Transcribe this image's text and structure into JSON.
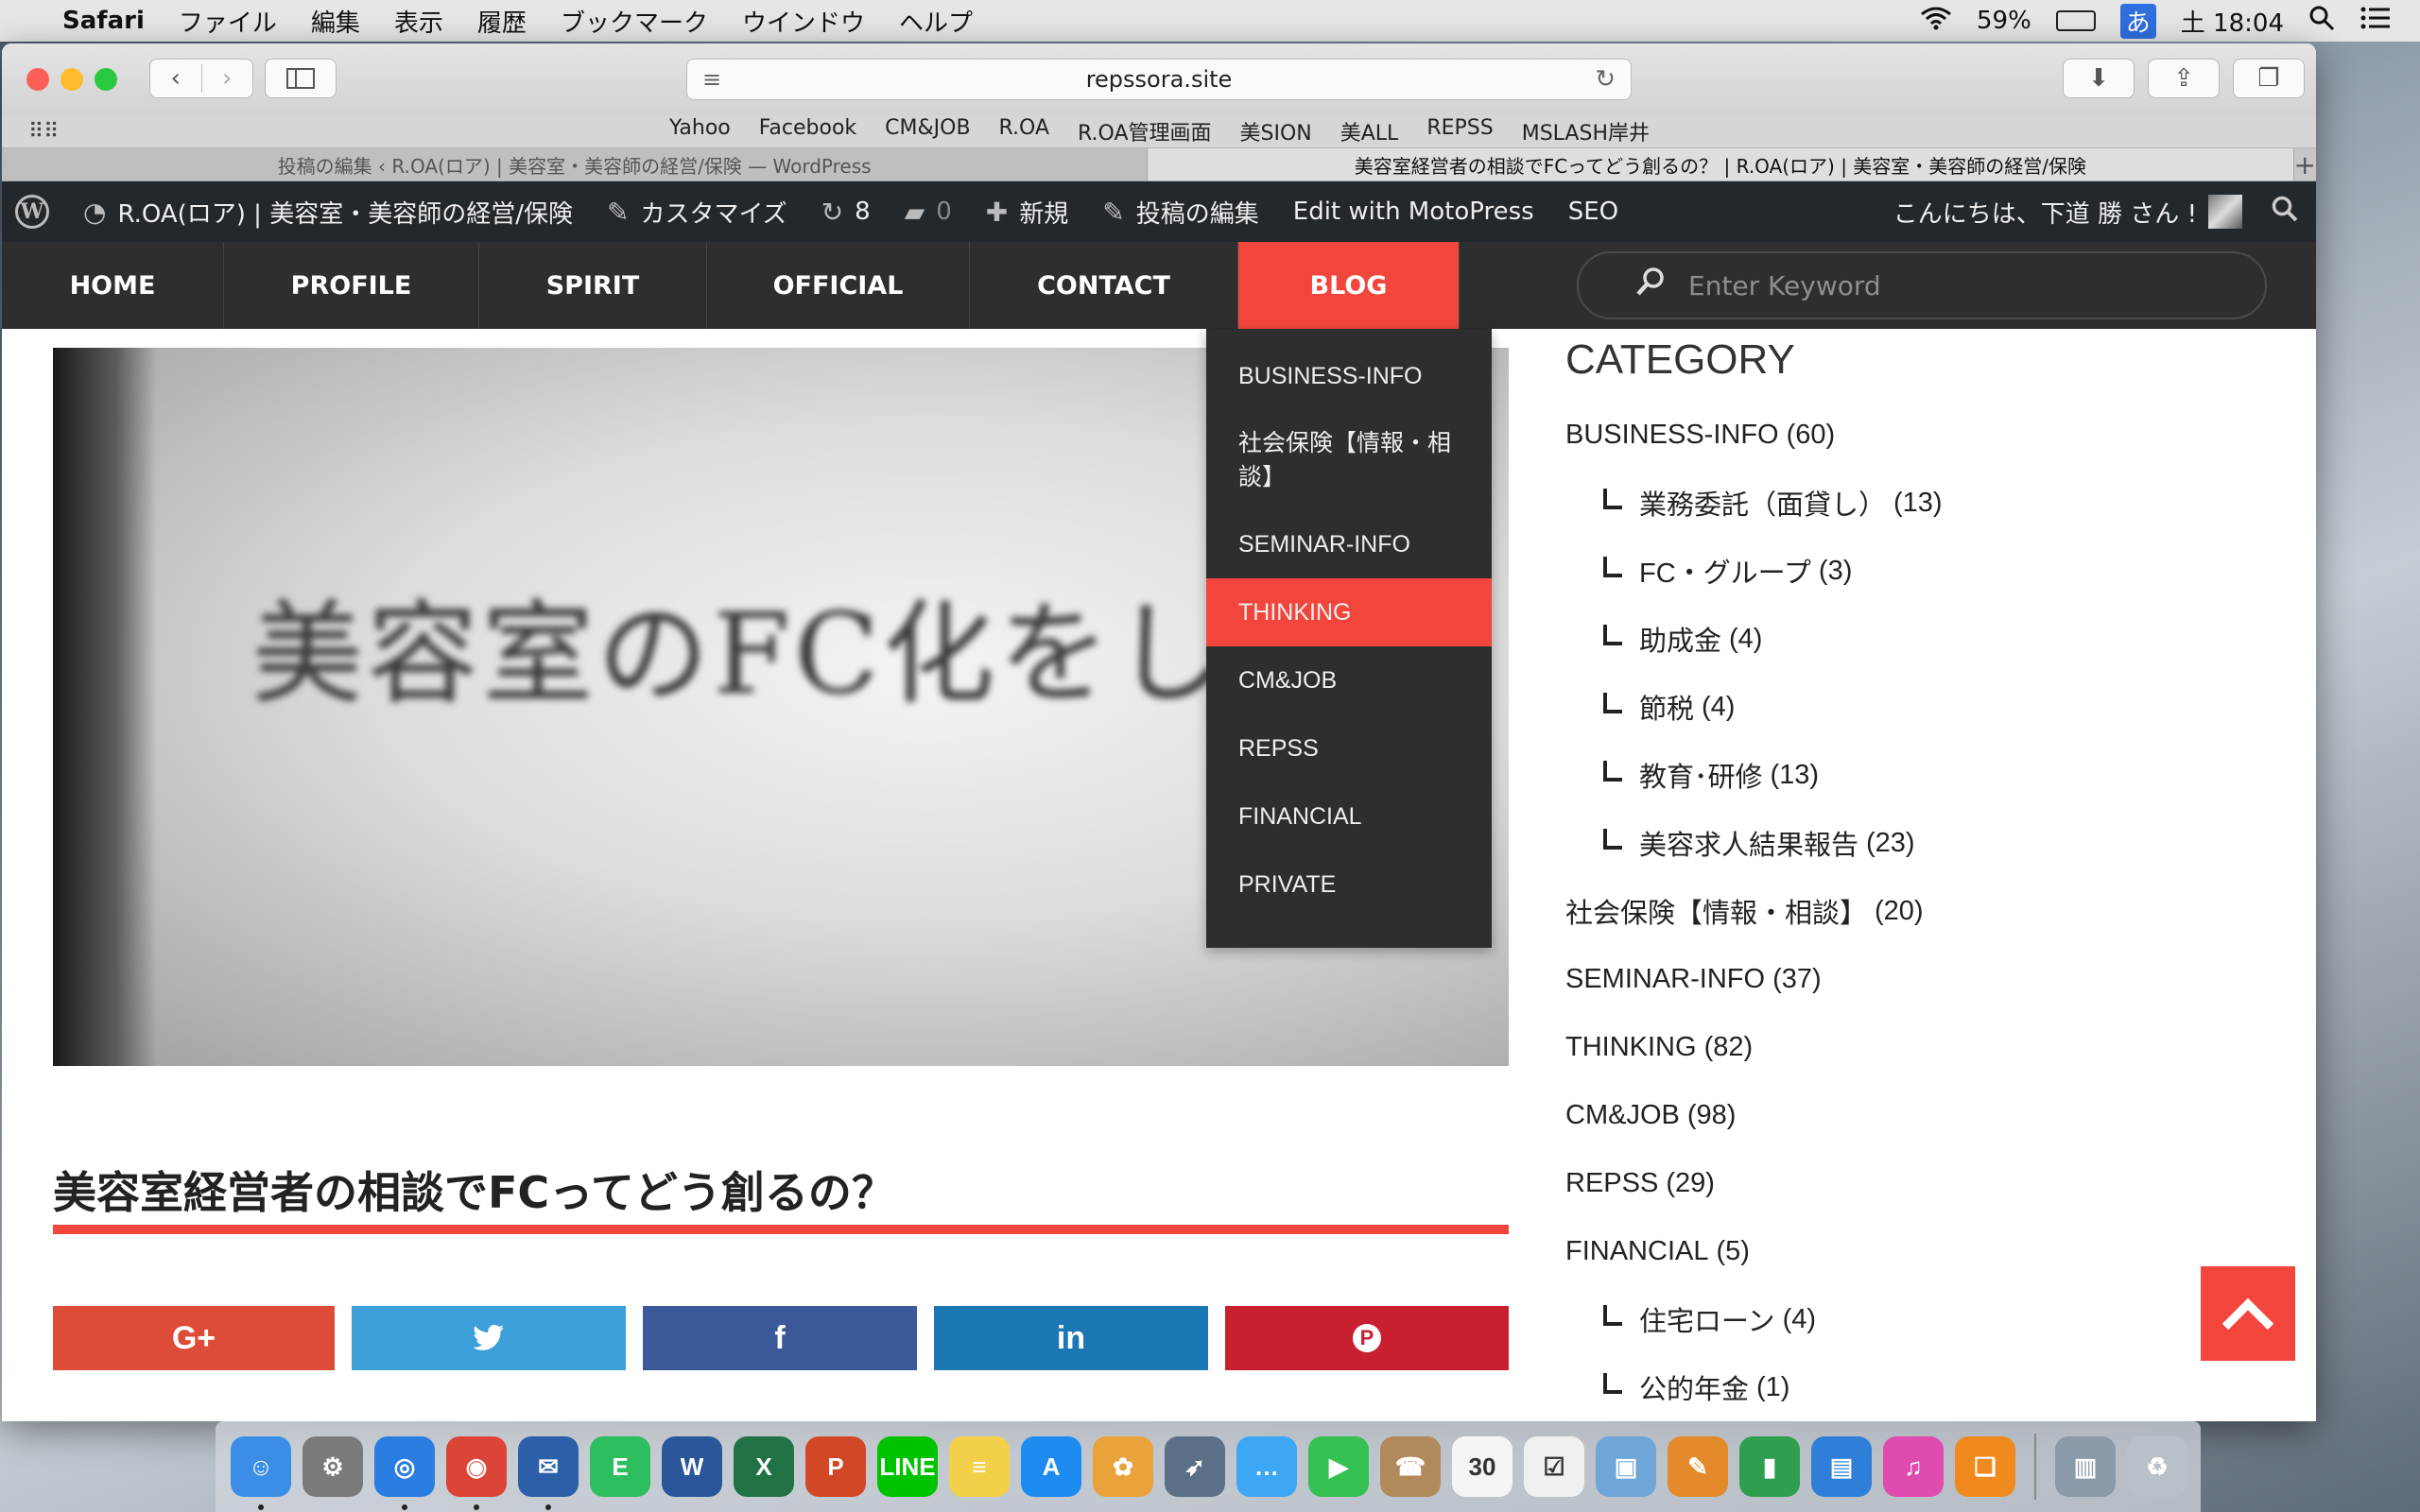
{
  "menubar": {
    "app": "Safari",
    "menus": [
      "ファイル",
      "編集",
      "表示",
      "履歴",
      "ブックマーク",
      "ウインドウ",
      "ヘルプ"
    ],
    "battery": "59%",
    "ime": "あ",
    "clock": "土 18:04"
  },
  "browser": {
    "url": "repssora.site",
    "favorites": [
      "Yahoo",
      "Facebook",
      "CM&JOB",
      "R.OA",
      "R.OA管理画面",
      "美SION",
      "美ALL",
      "REPSS",
      "MSLASH岸井"
    ],
    "tabs": [
      {
        "title": "投稿の編集 ‹ R.OA(ロア) | 美容室・美容師の経営/保険 — WordPress"
      },
      {
        "title": "美容室経営者の相談でFCってどう創るの？ | R.OA(ロア) | 美容室・美容師の経営/保険"
      }
    ],
    "new_tab": "+"
  },
  "adminbar": {
    "site": "R.OA(ロア) | 美容室・美容師の経営/保険",
    "customize": "カスタマイズ",
    "updates": "8",
    "comments": "0",
    "new": "新規",
    "edit_post": "投稿の編集",
    "motopress": "Edit with MotoPress",
    "seo": "SEO",
    "greeting": "こんにちは、下道 勝 さん !"
  },
  "nav": {
    "items": [
      "HOME",
      "PROFILE",
      "SPIRIT",
      "OFFICIAL",
      "CONTACT",
      "BLOG"
    ],
    "active": "BLOG",
    "search_placeholder": "Enter Keyword"
  },
  "dropdown": {
    "items": [
      "BUSINESS-INFO",
      "社会保険【情報・相談】",
      "SEMINAR-INFO",
      "THINKING",
      "CM&JOB",
      "REPSS",
      "FINANCIAL",
      "PRIVATE"
    ],
    "highlighted": "THINKING"
  },
  "post": {
    "hero_text": "美容室のFC化をした",
    "title": "美容室経営者の相談でFCってどう創るの？",
    "share": [
      {
        "label": "G+",
        "color": "#dd4b39"
      },
      {
        "label": "twitter",
        "color": "#3c9fd9"
      },
      {
        "label": "f",
        "color": "#3b5998"
      },
      {
        "label": "in",
        "color": "#1c77b5"
      },
      {
        "label": "P",
        "color": "#c8202f"
      }
    ]
  },
  "sidebar": {
    "heading": "CATEGORY",
    "categories": [
      {
        "name": "BUSINESS-INFO",
        "count": "(60)",
        "sub": false
      },
      {
        "name": "業務委託（面貸し）",
        "count": "(13)",
        "sub": true
      },
      {
        "name": "FC・グループ",
        "count": "(3)",
        "sub": true
      },
      {
        "name": "助成金",
        "count": "(4)",
        "sub": true
      },
      {
        "name": "節税",
        "count": "(4)",
        "sub": true
      },
      {
        "name": "教育･研修",
        "count": "(13)",
        "sub": true
      },
      {
        "name": "美容求人結果報告",
        "count": "(23)",
        "sub": true
      },
      {
        "name": "社会保険【情報・相談】",
        "count": "(20)",
        "sub": false
      },
      {
        "name": "SEMINAR-INFO",
        "count": "(37)",
        "sub": false
      },
      {
        "name": "THINKING",
        "count": "(82)",
        "sub": false
      },
      {
        "name": "CM&JOB",
        "count": "(98)",
        "sub": false
      },
      {
        "name": "REPSS",
        "count": "(29)",
        "sub": false
      },
      {
        "name": "FINANCIAL",
        "count": "(5)",
        "sub": false
      },
      {
        "name": "住宅ローン",
        "count": "(4)",
        "sub": true
      },
      {
        "name": "公的年金",
        "count": "(1)",
        "sub": true
      }
    ]
  },
  "dock": {
    "apps": [
      {
        "name": "finder-icon",
        "label": "☺",
        "color": "#3a8ee6",
        "running": true
      },
      {
        "name": "system-preferences-icon",
        "label": "⚙",
        "color": "#7a7a7a",
        "running": false
      },
      {
        "name": "safari-icon",
        "label": "◎",
        "color": "#2a7de1",
        "running": true
      },
      {
        "name": "chrome-icon",
        "label": "◉",
        "color": "#db4437",
        "running": true
      },
      {
        "name": "thunderbird-icon",
        "label": "✉",
        "color": "#2b5fa8",
        "running": true
      },
      {
        "name": "evernote-icon",
        "label": "E",
        "color": "#2dbe60",
        "running": false
      },
      {
        "name": "word-icon",
        "label": "W",
        "color": "#2b579a",
        "running": false
      },
      {
        "name": "excel-icon",
        "label": "X",
        "color": "#217346",
        "running": false
      },
      {
        "name": "powerpoint-icon",
        "label": "P",
        "color": "#d24726",
        "running": false
      },
      {
        "name": "line-icon",
        "label": "LINE",
        "color": "#00c300",
        "running": false
      },
      {
        "name": "notes-icon",
        "label": "≡",
        "color": "#f3d04a",
        "running": false
      },
      {
        "name": "app-store-icon",
        "label": "A",
        "color": "#1e8bf0",
        "running": false
      },
      {
        "name": "photos-icon",
        "label": "✿",
        "color": "#e9a33a",
        "running": false
      },
      {
        "name": "launchpad-icon",
        "label": "➶",
        "color": "#5b6f86",
        "running": false
      },
      {
        "name": "messages-icon",
        "label": "…",
        "color": "#3da6f5",
        "running": false
      },
      {
        "name": "facetime-icon",
        "label": "▶",
        "color": "#35c152",
        "running": false
      },
      {
        "name": "contacts-icon",
        "label": "☎",
        "color": "#b08a5a",
        "running": false
      },
      {
        "name": "calendar-icon",
        "label": "30",
        "color": "#f4f4f4",
        "running": false
      },
      {
        "name": "reminders-icon",
        "label": "☑",
        "color": "#f0f0f0",
        "running": false
      },
      {
        "name": "preview-icon",
        "label": "▣",
        "color": "#6ea6d8",
        "running": false
      },
      {
        "name": "pages-icon",
        "label": "✎",
        "color": "#e48a2a",
        "running": false
      },
      {
        "name": "numbers-icon",
        "label": "▮",
        "color": "#2e9e4f",
        "running": false
      },
      {
        "name": "keynote-icon",
        "label": "▤",
        "color": "#2f7fd8",
        "running": false
      },
      {
        "name": "itunes-icon",
        "label": "♫",
        "color": "#e04bb0",
        "running": false
      },
      {
        "name": "ibooks-icon",
        "label": "❑",
        "color": "#f08a1e",
        "running": false
      },
      {
        "name": "documents-icon",
        "label": "▥",
        "color": "#8a9aa8",
        "running": false
      },
      {
        "name": "trash-icon",
        "label": "♻",
        "color": "#b8c0c8",
        "running": false
      }
    ]
  }
}
